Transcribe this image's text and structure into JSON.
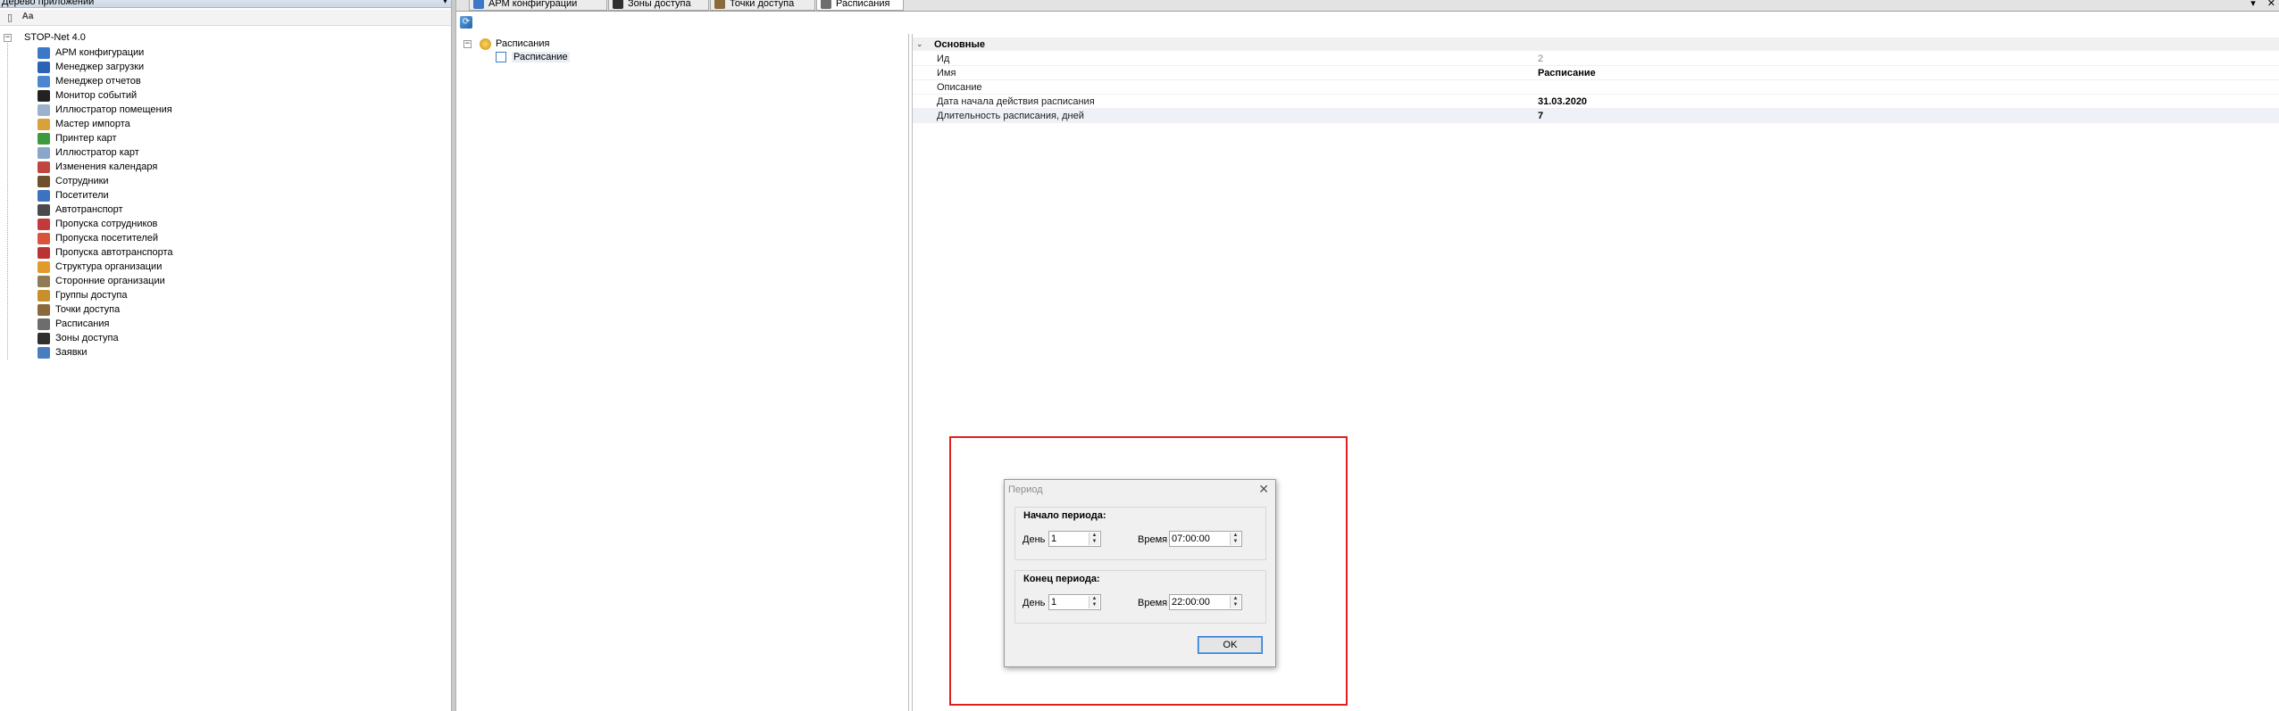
{
  "left_panel": {
    "title": "Дерево приложений",
    "pin_glyph": "▾",
    "toolbar": {
      "btn1_glyph": "▯",
      "btn2_glyph": "Aa"
    },
    "root": "STOP-Net 4.0",
    "expander": "−",
    "items": [
      {
        "label": "АРМ конфигурации",
        "color": "#3c78c8"
      },
      {
        "label": "Менеджер загрузки",
        "color": "#2a62b5"
      },
      {
        "label": "Менеджер отчетов",
        "color": "#4d86cf"
      },
      {
        "label": "Монитор событий",
        "color": "#222222"
      },
      {
        "label": "Иллюстратор помещения",
        "color": "#9bb2cf"
      },
      {
        "label": "Мастер импорта",
        "color": "#d9a13a"
      },
      {
        "label": "Принтер карт",
        "color": "#3f9a3f"
      },
      {
        "label": "Иллюстратор карт",
        "color": "#8aa6c8"
      },
      {
        "label": "Изменения календаря",
        "color": "#c0453f"
      },
      {
        "label": "Сотрудники",
        "color": "#6f4f2d"
      },
      {
        "label": "Посетители",
        "color": "#3b73c0"
      },
      {
        "label": "Автотранспорт",
        "color": "#4a4a4a"
      },
      {
        "label": "Пропуска сотрудников",
        "color": "#c43a3a"
      },
      {
        "label": "Пропуска посетителей",
        "color": "#d8543b"
      },
      {
        "label": "Пропуска автотранспорта",
        "color": "#bb3434"
      },
      {
        "label": "Структура организации",
        "color": "#e29b2a"
      },
      {
        "label": "Сторонние организации",
        "color": "#8f7b56"
      },
      {
        "label": "Группы доступа",
        "color": "#c7902b"
      },
      {
        "label": "Точки доступа",
        "color": "#8a6a3a"
      },
      {
        "label": "Расписания",
        "color": "#6d6d6d"
      },
      {
        "label": "Зоны доступа",
        "color": "#2f2f2f"
      },
      {
        "label": "Заявки",
        "color": "#4a7cc0"
      }
    ]
  },
  "tabs": [
    {
      "label": "АРМ конфигурации",
      "color": "#3c78c8"
    },
    {
      "label": "Зоны доступа",
      "color": "#2f2f2f"
    },
    {
      "label": "Точки доступа",
      "color": "#8a6a3a"
    },
    {
      "label": "Расписания",
      "color": "#6d6d6d"
    }
  ],
  "tab_controls": {
    "dropdown": "▾",
    "close": "✕"
  },
  "content_toolbar": {
    "refresh_glyph": "⟳"
  },
  "schedule_tree": {
    "expander": "−",
    "root": "Расписания",
    "child": "Расписание"
  },
  "properties": {
    "category": "Основные",
    "chevron": "⌄",
    "rows": [
      {
        "name": "Ид",
        "value": "2"
      },
      {
        "name": "Имя",
        "value": "Расписание"
      },
      {
        "name": "Описание",
        "value": ""
      },
      {
        "name": "Дата начала действия расписания",
        "value": "31.03.2020"
      },
      {
        "name": "Длительность расписания, дней",
        "value": "7"
      }
    ]
  },
  "dialog": {
    "title": "Период",
    "close_glyph": "✕",
    "start": {
      "title": "Начало периода:",
      "day_label": "День",
      "day_value": "1",
      "time_label": "Время",
      "time_value": "07:00:00"
    },
    "end": {
      "title": "Конец периода:",
      "day_label": "День",
      "day_value": "1",
      "time_label": "Время",
      "time_value": "22:00:00"
    },
    "spin_up": "▲",
    "spin_down": "▼",
    "ok_label": "OK"
  },
  "colors": {
    "highlight": "#e01f1f",
    "accent": "#2e7ad1"
  }
}
